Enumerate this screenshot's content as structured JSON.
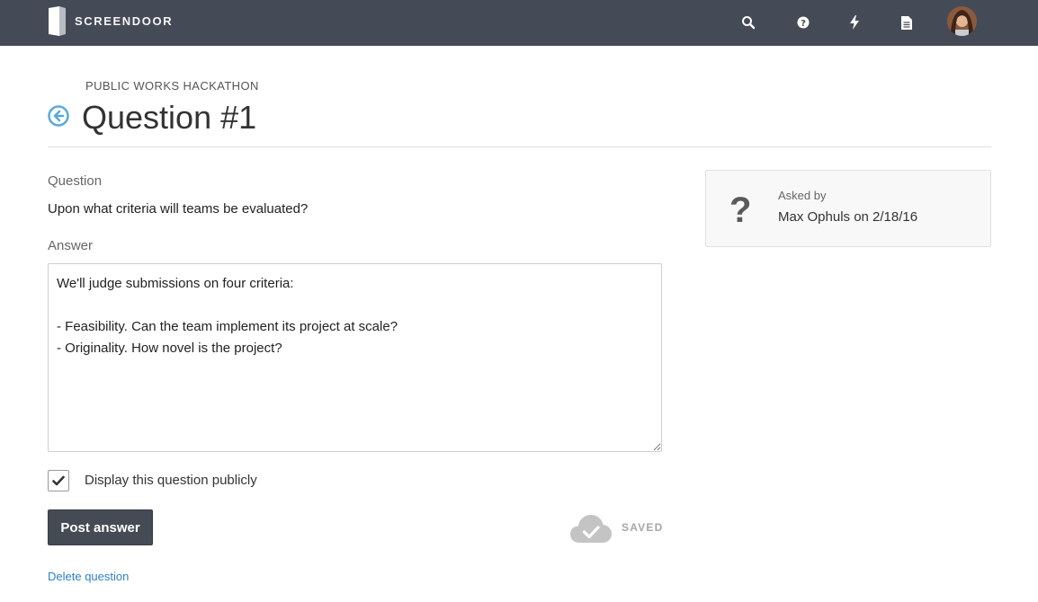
{
  "app": {
    "name": "SCREENDOOR"
  },
  "nav": {
    "icons": [
      "search-icon",
      "help-icon",
      "bolt-icon",
      "document-icon"
    ],
    "avatar": "user-avatar"
  },
  "header": {
    "org_name": "PUBLIC WORKS HACKATHON",
    "title": "Question #1"
  },
  "form": {
    "question_label": "Question",
    "question_text": "Upon what criteria will teams be evaluated?",
    "answer_label": "Answer",
    "answer_value": "We'll judge submissions on four criteria:\n\n- Feasibility. Can the team implement its project at scale?\n- Originality. How novel is the project?",
    "display_publicly_label": "Display this question publicly",
    "display_publicly_checked": true,
    "post_button_label": "Post answer",
    "saved_status": "SAVED",
    "delete_link": "Delete question"
  },
  "asked_by": {
    "label": "Asked by",
    "value": "Max Ophuls on 2/18/16"
  },
  "colors": {
    "topbar": "#454b56",
    "primary_button": "#444b55",
    "link": "#2f80c4",
    "back_icon": "#5aa9dd"
  }
}
